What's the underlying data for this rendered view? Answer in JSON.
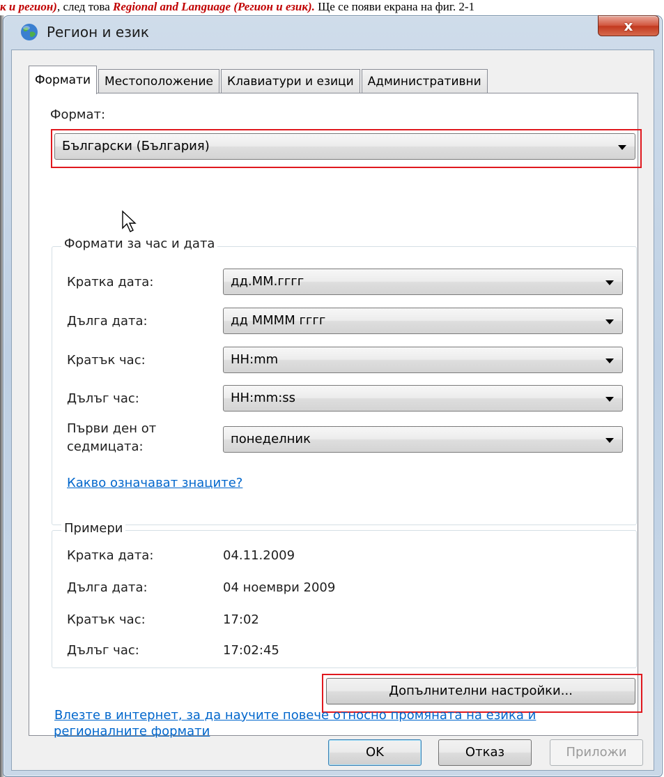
{
  "doc_strip": {
    "prefix": "",
    "hl1": "к и регион)",
    "mid": ", след това ",
    "hl2": "Regional and Language (Регион и език).",
    "suffix": " Ще се появи екрана на фиг. 2-1"
  },
  "window": {
    "title": "Регион и език",
    "close_glyph": "x"
  },
  "tabs": [
    "Формати",
    "Местоположение",
    "Клавиатури и езици",
    "Административни"
  ],
  "format": {
    "label": "Формат:",
    "value": "Български (България)"
  },
  "datetime_group": {
    "title": "Формати за час и дата",
    "rows": [
      {
        "label": "Кратка дата:",
        "value": "дд.ММ.гггг"
      },
      {
        "label": "Дълга дата:",
        "value": "дд ММММ гггг"
      },
      {
        "label": "Кратък час:",
        "value": "HH:mm"
      },
      {
        "label": "Дълъг час:",
        "value": "HH:mm:ss"
      },
      {
        "label": "Първи ден от седмицата:",
        "label_line1": "Първи ден от",
        "label_line2": "седмицата:",
        "value": "понеделник"
      }
    ],
    "help_link": "Какво означават знаците?"
  },
  "examples_group": {
    "title": "Примери",
    "rows": [
      {
        "label": "Кратка дата:",
        "value": "04.11.2009"
      },
      {
        "label": "Дълга дата:",
        "value": "04 ноември 2009"
      },
      {
        "label": "Кратък час:",
        "value": "17:02"
      },
      {
        "label": "Дълъг час:",
        "value": "17:02:45"
      }
    ]
  },
  "additional_settings_label": "Допълнителни настройки...",
  "online_link": {
    "line1": "Влезте в интернет, за да научите повече относно промяната на езика и",
    "line2": "регионалните формати"
  },
  "buttons": {
    "ok": "OK",
    "cancel": "Отказ",
    "apply": "Приложи"
  },
  "colors": {
    "highlight_box": "#e0181e",
    "link": "#0066cc"
  }
}
